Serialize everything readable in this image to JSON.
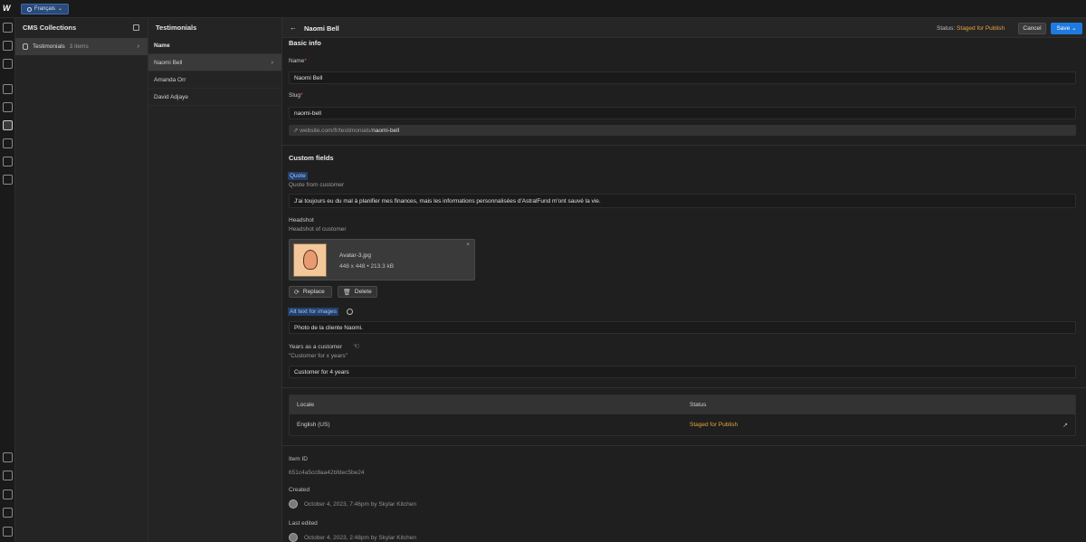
{
  "topbar": {
    "locale_pill": "Français"
  },
  "rail": {
    "icons": [
      "add-icon",
      "page-icon",
      "navigator-icon",
      "components-icon",
      "assets-icon",
      "cms-icon",
      "logic-icon",
      "users-icon",
      "ecommerce-icon",
      "settings-icon",
      "audit-icon",
      "tasks-icon",
      "search-icon",
      "apps-icon"
    ]
  },
  "collections": {
    "header": "CMS Collections",
    "items": [
      {
        "label": "Testimonials",
        "count": "3 items"
      }
    ]
  },
  "items_panel": {
    "header": "Testimonials",
    "column": "Name",
    "rows": [
      "Naomi Bell",
      "Amanda Orr",
      "David Adjaye"
    ]
  },
  "editor": {
    "title": "Naomi Bell",
    "status_label": "Status:",
    "status_value": "Staged for Publish",
    "cancel": "Cancel",
    "save": "Save",
    "basic_info": "Basic info",
    "name_label": "Name",
    "name_value": "Naomi Bell",
    "slug_label": "Slug",
    "slug_value": "naomi-bell",
    "url_prefix": "website.com/fr/testimonials/",
    "url_slug": "naomi-bell",
    "custom_fields": "Custom fields",
    "quote_label": "Quote",
    "quote_help": "Quote from customer",
    "quote_value": "J'ai toujours eu du mal à planifier mes finances, mais les informations personnalisées d'AstralFund m'ont sauvé la vie.",
    "headshot_label": "Headshot",
    "headshot_help": "Headshot of customer",
    "image_name": "Avatar-3.jpg",
    "image_meta": "448 x 448 • 213.3 kB",
    "replace": "Replace",
    "delete": "Delete",
    "alt_label": "Alt text for images",
    "alt_value": "Photo de la cliente Naomi.",
    "years_label": "Years as a customer",
    "years_help": "\"Customer for x years\"",
    "years_value": "Customer for 4 years",
    "locale_table": {
      "col_locale": "Locale",
      "col_status": "Status",
      "row_locale": "English (US)",
      "row_status": "Staged for Publish"
    },
    "item_id_label": "Item ID",
    "item_id_value": "651c4a5cc8aa42bfdec5be24",
    "created_label": "Created",
    "created_value": "October 4, 2023, 7:46pm by Skylar Kitchen",
    "edited_label": "Last edited",
    "edited_value": "October 4, 2023, 2:48pm by Skylar Kitchen"
  },
  "colors": {
    "accent": "#1f7ae0",
    "status": "#e8a33c",
    "highlight": "#24406a"
  }
}
